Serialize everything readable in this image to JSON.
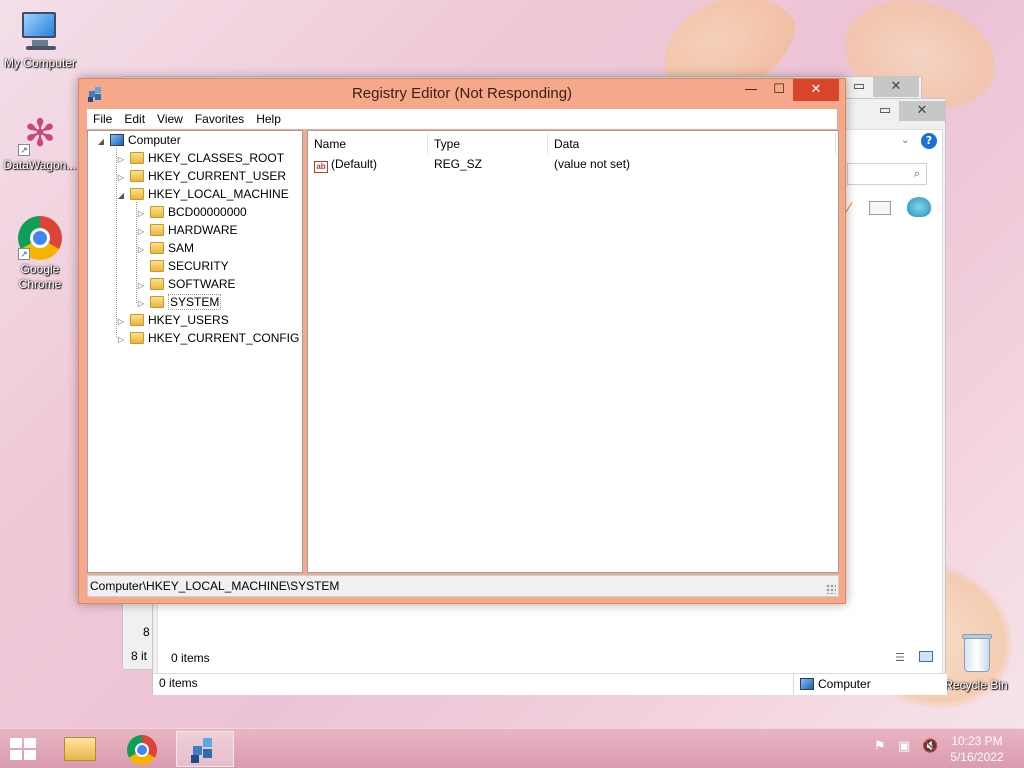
{
  "desktop": {
    "icons": [
      {
        "label": "My Computer"
      },
      {
        "label": "DataWagon..."
      },
      {
        "label": "Google Chrome"
      },
      {
        "label": "Recycle Bin"
      }
    ]
  },
  "background_windows": {
    "front": {
      "items_label": "0 items",
      "status_left": "0 items",
      "status_right": "Computer"
    },
    "back": {
      "items_partial": "8 it",
      "number_partial": "8"
    }
  },
  "registry_editor": {
    "title": "Registry Editor (Not Responding)",
    "menu": [
      "File",
      "Edit",
      "View",
      "Favorites",
      "Help"
    ],
    "tree": {
      "root": "Computer",
      "hives": [
        {
          "label": "HKEY_CLASSES_ROOT"
        },
        {
          "label": "HKEY_CURRENT_USER"
        },
        {
          "label": "HKEY_LOCAL_MACHINE",
          "children": [
            "BCD00000000",
            "HARDWARE",
            "SAM",
            "SECURITY",
            "SOFTWARE",
            "SYSTEM"
          ]
        },
        {
          "label": "HKEY_USERS"
        },
        {
          "label": "HKEY_CURRENT_CONFIG"
        }
      ]
    },
    "columns": [
      "Name",
      "Type",
      "Data"
    ],
    "values": [
      {
        "name": "(Default)",
        "type": "REG_SZ",
        "data": "(value not set)"
      }
    ],
    "status_path": "Computer\\HKEY_LOCAL_MACHINE\\SYSTEM"
  },
  "taskbar": {
    "time": "10:23 PM",
    "date": "5/16/2022"
  },
  "colors": {
    "title_bar": "#f6a98a",
    "close_button": "#d9452d",
    "taskbar": "#d99bb0"
  }
}
